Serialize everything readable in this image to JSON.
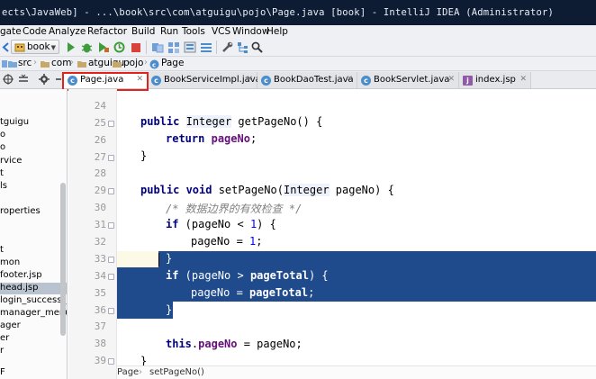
{
  "window": {
    "title": "ects\\JavaWeb] - ...\\book\\src\\com\\atguigu\\pojo\\Page.java [book] - IntelliJ IDEA (Administrator)"
  },
  "menu": [
    "gate",
    "Code",
    "Analyze",
    "Refactor",
    "Build",
    "Run",
    "Tools",
    "VCS",
    "Window",
    "Help"
  ],
  "toolbar": {
    "config_label": "book"
  },
  "breadcrumb": [
    "src",
    "com",
    "atguigu",
    "pojo",
    "Page"
  ],
  "tabs": [
    {
      "label": "Page.java",
      "icon": "class-icon",
      "active": true
    },
    {
      "label": "BookServiceImpl.java",
      "icon": "class-icon"
    },
    {
      "label": "BookDaoTest.java",
      "icon": "class-icon"
    },
    {
      "label": "BookServlet.java",
      "icon": "class-icon"
    },
    {
      "label": "index.jsp",
      "icon": "jsp-icon"
    }
  ],
  "project_tree": [
    "tguigu",
    "o",
    "o",
    "rvice",
    "t",
    "ls",
    "roperties",
    "t",
    "mon",
    "footer.jsp",
    "head.jsp",
    "login_success_m",
    "manager_menu.js",
    "ager",
    "er",
    "r",
    "F"
  ],
  "editor": {
    "line_numbers": [
      "24",
      "25",
      "26",
      "27",
      "28",
      "29",
      "30",
      "31",
      "32",
      "33",
      "34",
      "35",
      "36",
      "37",
      "38",
      "39"
    ],
    "code": {
      "l25_kw": "public",
      "l25_type": "Integer",
      "l25_rest": " getPageNo() {",
      "l26_kw": "return",
      "l26_field": "pageNo",
      "l26_rest": ";",
      "l27": "}",
      "l29_kw": "public void",
      "l29_name": " setPageNo(",
      "l29_type": "Integer",
      "l29_rest": " pageNo) {",
      "l30_comment": "/* 数据边界的有效检查 */",
      "l31_kw": "if",
      "l31_a": " (pageNo < ",
      "l31_num": "1",
      "l31_b": ") {",
      "l32_a": "pageNo = ",
      "l32_num": "1",
      "l32_b": ";",
      "l33": "}",
      "l34_kw": "if",
      "l34_a": " (pageNo > ",
      "l34_field": "pageTotal",
      "l34_b": ") {",
      "l35_a": "pageNo = ",
      "l35_field": "pageTotal",
      "l35_b": ";",
      "l36": "}",
      "l38_kw": "this",
      "l38_a": ".",
      "l38_field": "pageNo",
      "l38_b": " = pageNo;",
      "l39": "}"
    }
  },
  "status": {
    "class_crumb": "Page",
    "method_crumb": "setPageNo()"
  }
}
